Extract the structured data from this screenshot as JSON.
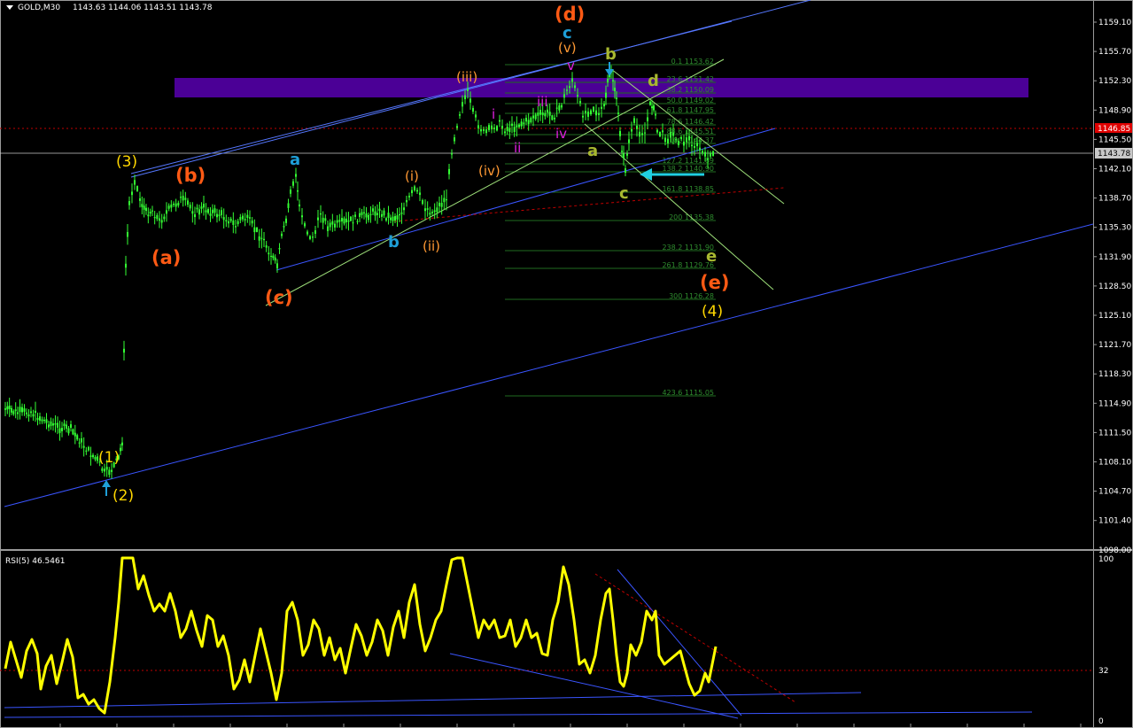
{
  "header": {
    "symbol_label": "GOLD,M30",
    "ohlc": "1143.63 1144.06 1143.51 1143.78"
  },
  "price_axis": {
    "ticks": [
      "1159.10",
      "1155.70",
      "1152.30",
      "1148.90",
      "1145.50",
      "1142.10",
      "1138.70",
      "1135.30",
      "1131.90",
      "1128.50",
      "1125.10",
      "1121.70",
      "1118.30",
      "1114.90",
      "1111.50",
      "1108.10",
      "1104.70",
      "1101.40",
      "1098.00"
    ],
    "current_price": "1143.78",
    "red_line_price": "1146.85"
  },
  "rsi": {
    "label": "RSI(5) 46.5461",
    "axis_ticks": [
      "100",
      "32",
      "0"
    ]
  },
  "fib_levels": [
    {
      "text": "0.1 1153.62"
    },
    {
      "text": "23.6 1151.42"
    },
    {
      "text": "38.2 1150.09"
    },
    {
      "text": "50.0 1149.02"
    },
    {
      "text": "61.8 1147.95"
    },
    {
      "text": "78.6 1146.42"
    },
    {
      "text": "88.6 1145.51"
    },
    {
      "text": "100 1144.37"
    },
    {
      "text": "127.2 1141.89"
    },
    {
      "text": "138.2 1140.90"
    },
    {
      "text": "161.8 1138.85"
    },
    {
      "text": "200 1135.38"
    },
    {
      "text": "238.2 1131.90"
    },
    {
      "text": "261.8 1129.76"
    },
    {
      "text": "300 1126.28"
    },
    {
      "text": "423.6 1115.05"
    }
  ],
  "wave_labels": [
    {
      "text": "(1)",
      "color": "#ffd700"
    },
    {
      "text": "(2)",
      "color": "#ffd700"
    },
    {
      "text": "(3)",
      "color": "#ffd700"
    },
    {
      "text": "(4)",
      "color": "#ffd700"
    },
    {
      "text": "(a)",
      "color": "#ff5a14"
    },
    {
      "text": "(b)",
      "color": "#ff5a14"
    },
    {
      "text": "(c)",
      "color": "#ff5a14"
    },
    {
      "text": "(d)",
      "color": "#ff5a14"
    },
    {
      "text": "(e)",
      "color": "#ff5a14"
    },
    {
      "text": "a",
      "color": "#1e9fd8"
    },
    {
      "text": "b",
      "color": "#1e9fd8"
    },
    {
      "text": "c",
      "color": "#1e9fd8"
    },
    {
      "text": "(i)",
      "color": "#ff9933"
    },
    {
      "text": "(ii)",
      "color": "#ff9933"
    },
    {
      "text": "(iii)",
      "color": "#ff9933"
    },
    {
      "text": "(iv)",
      "color": "#ff9933"
    },
    {
      "text": "(v)",
      "color": "#ff9933"
    },
    {
      "text": "i",
      "color": "#e020e0"
    },
    {
      "text": "ii",
      "color": "#e020e0"
    },
    {
      "text": "iii",
      "color": "#e020e0"
    },
    {
      "text": "iv",
      "color": "#e020e0"
    },
    {
      "text": "v",
      "color": "#e020e0"
    },
    {
      "text": "a",
      "color": "#a8b830"
    },
    {
      "text": "b",
      "color": "#a8b830"
    },
    {
      "text": "c",
      "color": "#a8b830"
    },
    {
      "text": "d",
      "color": "#a8b830"
    },
    {
      "text": "e",
      "color": "#a8b830"
    }
  ],
  "colors": {
    "background": "#000000",
    "candles": "#33ff33",
    "rsi_line": "#ffff00",
    "trendline": "#3a55ff",
    "zone": "#4b0096",
    "current_price_box": "#c8c8c8",
    "red_level_box": "#e00000"
  }
}
